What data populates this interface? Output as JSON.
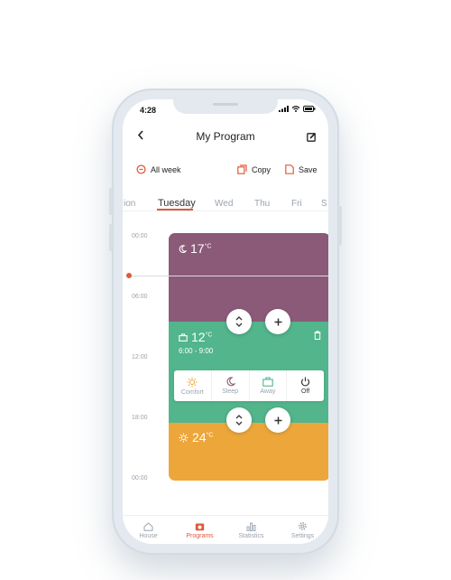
{
  "status": {
    "time": "4:28"
  },
  "header": {
    "title": "My Program"
  },
  "toolbar": {
    "all_week": "All week",
    "copy": "Copy",
    "save": "Save"
  },
  "days": [
    "ion",
    "Tuesday",
    "Wed",
    "Thu",
    "Fri",
    "S"
  ],
  "active_day": "Tuesday",
  "hours": [
    "00:00",
    "06:00",
    "12:00",
    "18:00",
    "00:00"
  ],
  "blocks": [
    {
      "mode": "sleep",
      "temp": "17",
      "unit": "°C",
      "color": "#8b5a78"
    },
    {
      "mode": "away",
      "temp": "12",
      "unit": "°C",
      "range": "6:00 - 9:00",
      "color": "#52b58c"
    },
    {
      "mode": "comfort",
      "temp": "24",
      "unit": "°C",
      "color": "#eda63a"
    }
  ],
  "mode_picker": {
    "comfort": "Comfort",
    "sleep": "Sleep",
    "away": "Away",
    "off": "Off"
  },
  "tabbar": {
    "house": "House",
    "programs": "Programs",
    "statistics": "Statistics",
    "settings": "Settings",
    "active": "Programs"
  },
  "colors": {
    "accent": "#e05a3a",
    "sleep": "#8b5a78",
    "away": "#52b58c",
    "comfort": "#eda63a"
  }
}
